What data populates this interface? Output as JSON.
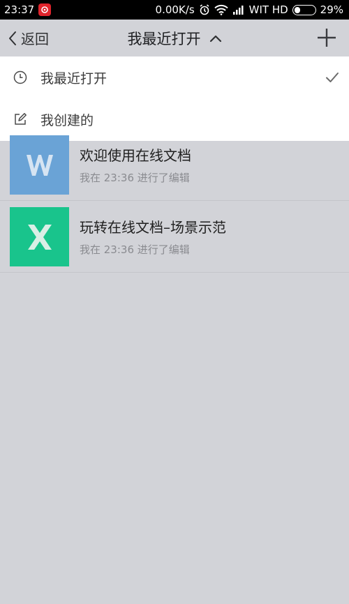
{
  "status_bar": {
    "time": "23:37",
    "speed": "0.00K/s",
    "carrier": "WIT HD",
    "battery": "29%",
    "battery_level": 0.29
  },
  "nav": {
    "back_label": "返回",
    "title": "我最近打开",
    "icons": {
      "back": "chevron-left-icon",
      "title_toggle": "chevron-up-icon",
      "add": "plus-icon"
    }
  },
  "dropdown": {
    "items": [
      {
        "label": "我最近打开",
        "icon": "clock-icon",
        "selected": true
      },
      {
        "label": "我创建的",
        "icon": "edit-icon",
        "selected": false
      }
    ]
  },
  "documents": [
    {
      "title": "欢迎使用在线文档",
      "subtitle": "我在 23:36 进行了编辑",
      "type": "W",
      "color": "#5b9bd5"
    },
    {
      "title": "玩转在线文档–场景示范",
      "subtitle": "我在 23:36 进行了编辑",
      "type": "X",
      "color": "#1bbd8a"
    }
  ],
  "colors": {
    "overlay": "#d2d3d8",
    "word_thumb_dim": "#6aa3d6",
    "excel_thumb_dim": "#19c48c"
  }
}
